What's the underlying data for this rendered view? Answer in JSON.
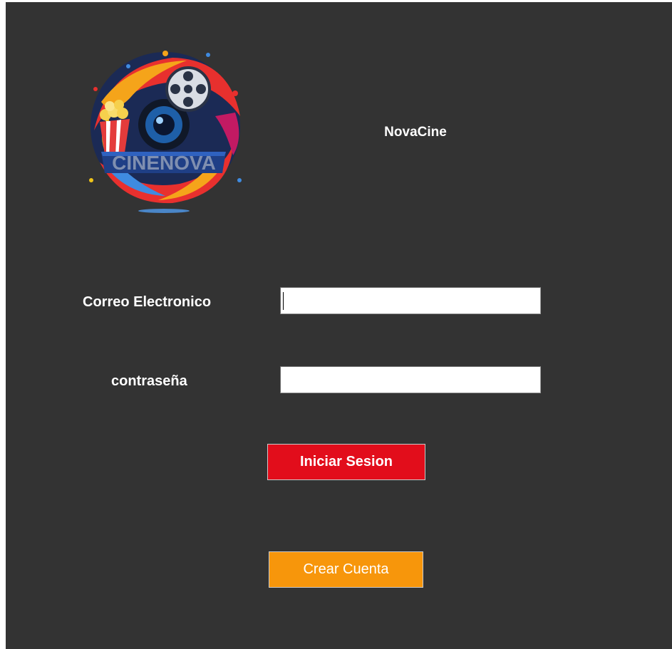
{
  "app": {
    "title": "NovaCine",
    "logo_text": "CINENOVA"
  },
  "form": {
    "email_label": "Correo Electronico",
    "email_value": "",
    "password_label": "contraseña",
    "password_value": ""
  },
  "buttons": {
    "login_label": "Iniciar Sesion",
    "create_label": "Crear Cuenta"
  },
  "colors": {
    "background": "#333333",
    "login_button": "#e20d1b",
    "create_button": "#f7960b"
  }
}
